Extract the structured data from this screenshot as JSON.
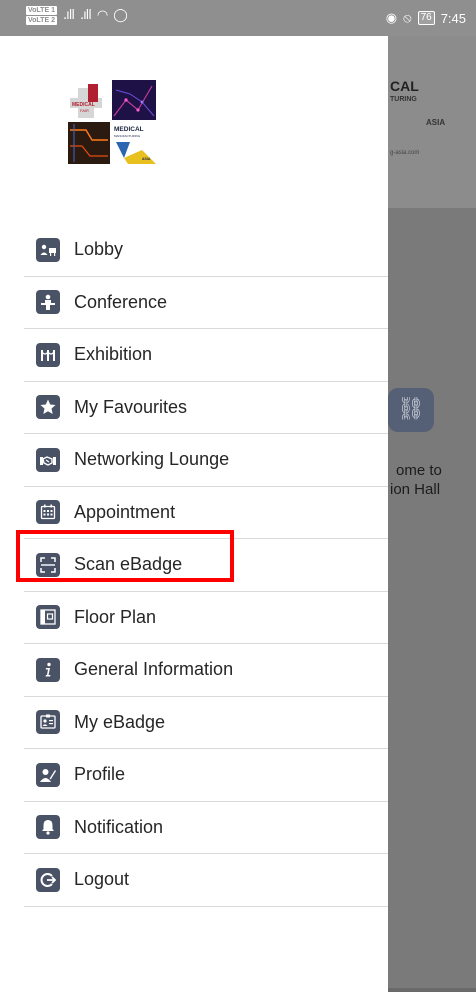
{
  "status_bar": {
    "volte_top": "VoLTE 1",
    "volte_bottom": "VoLTE 2",
    "battery": "76",
    "time": "7:45"
  },
  "background": {
    "banner_word1": "CAL",
    "banner_word2": "TURING",
    "banner_word3": "ASIA",
    "banner_word4": "g-asia.com",
    "welcome_line1": "ome to",
    "welcome_line2": "ion Hall"
  },
  "logo": {
    "text1": "MEDICAL",
    "text2": "FAIR",
    "text3": "MEDICAL",
    "text4": "MANUFACTURING",
    "text5": "ASIA"
  },
  "menu": {
    "items": [
      {
        "label": "Lobby",
        "icon": "lobby-icon"
      },
      {
        "label": "Conference",
        "icon": "conference-icon"
      },
      {
        "label": "Exhibition",
        "icon": "exhibition-icon"
      },
      {
        "label": "My Favourites",
        "icon": "star-icon"
      },
      {
        "label": "Networking Lounge",
        "icon": "handshake-icon"
      },
      {
        "label": "Appointment",
        "icon": "calendar-icon"
      },
      {
        "label": "Scan eBadge",
        "icon": "scan-icon"
      },
      {
        "label": "Floor Plan",
        "icon": "floor-plan-icon"
      },
      {
        "label": "General Information",
        "icon": "info-icon"
      },
      {
        "label": "My eBadge",
        "icon": "badge-icon"
      },
      {
        "label": "Profile",
        "icon": "profile-icon"
      },
      {
        "label": "Notification",
        "icon": "bell-icon"
      },
      {
        "label": "Logout",
        "icon": "logout-icon"
      }
    ]
  },
  "colors": {
    "icon_bg": "#4a5366",
    "highlight": "#ff0000"
  }
}
